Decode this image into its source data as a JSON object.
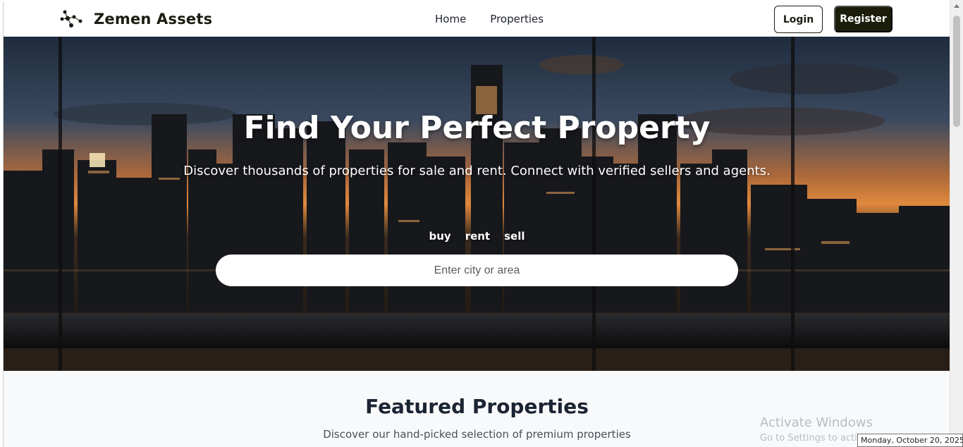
{
  "navbar": {
    "brand_name": "Zemen Assets",
    "brand_icon": "molecule-logo-icon",
    "links": [
      "Home",
      "Properties"
    ],
    "login_label": "Login",
    "register_label": "Register"
  },
  "hero": {
    "title": "Find Your Perfect Property",
    "subtitle": "Discover thousands of properties for sale and rent. Connect with verified sellers and agents.",
    "modes": [
      "buy",
      "rent",
      "sell"
    ],
    "search_placeholder": "Enter city or area"
  },
  "featured": {
    "title": "Featured Properties",
    "subtitle": "Discover our hand-picked selection of premium properties"
  },
  "os_overlay": {
    "activate_title": "Activate Windows",
    "activate_sub": "Go to Settings to activate Windows.",
    "date_tooltip": "Monday, October 20, 2025"
  },
  "colors": {
    "brand_dark": "#1b1d0a",
    "text_dark": "#1b2432",
    "page_bg": "#f8f9fb"
  }
}
